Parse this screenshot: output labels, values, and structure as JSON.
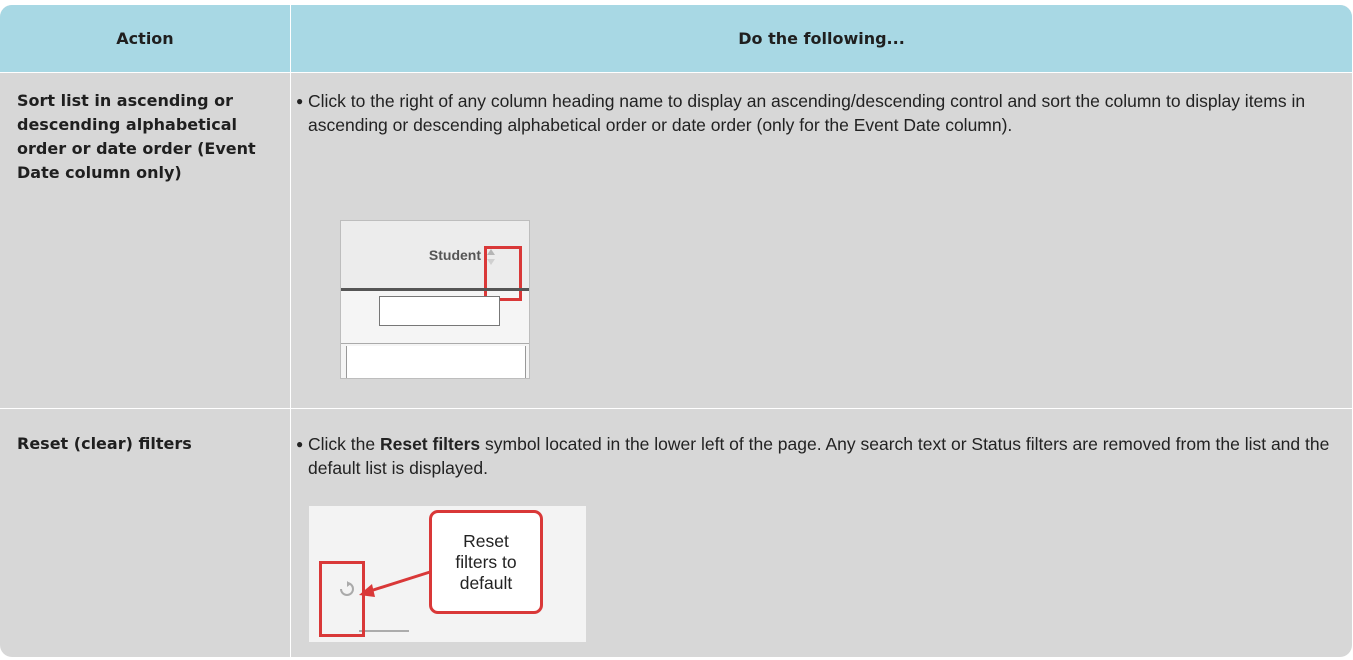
{
  "header": {
    "col1": "Action",
    "col2": "Do the following..."
  },
  "rows": [
    {
      "action": "Sort list in ascending or descending alphabetical order or date order (Event Date column only)",
      "text": "Click to the right of any column heading name to display an ascending/descending control and sort the column to display items in ascending or descending alphabetical order or date order (only for the Event Date column).",
      "image": {
        "column_label": "Student"
      }
    },
    {
      "action": "Reset (clear) filters",
      "text_pre": "Click the ",
      "text_bold": "Reset filters",
      "text_post": " symbol located in the lower left of the page. Any search text or Status filters are removed from the list and the default list is displayed.",
      "image": {
        "callout_line1": "Reset",
        "callout_line2": "filters to",
        "callout_line3": "default"
      }
    }
  ],
  "colors": {
    "header_bg": "#a8d8e4",
    "row_bg": "#d7d7d7",
    "highlight": "#d93838"
  }
}
